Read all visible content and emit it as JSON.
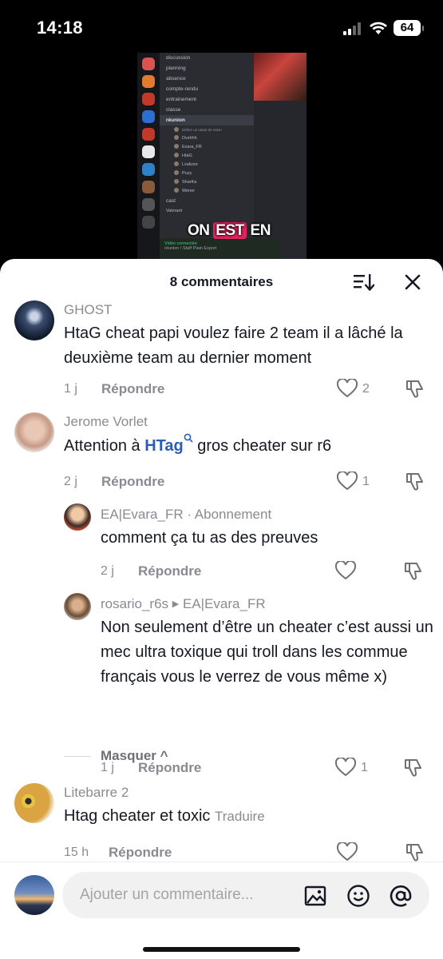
{
  "status_bar": {
    "time": "14:18",
    "battery": "64"
  },
  "video": {
    "caption_parts": [
      "ON",
      "EST",
      "EN"
    ],
    "channels": [
      "discussion",
      "planning",
      "absence",
      "compte-rendu",
      "entrainement",
      "classe"
    ],
    "voice_channel": "réunion",
    "voice_status": "Définir un statut de salon",
    "voice_users": [
      "Dvshhh",
      "Evara_FR",
      "HtaG",
      "Lvalizze",
      "Puzy",
      "SharKa",
      "Wener"
    ],
    "other_channels": [
      "cast"
    ],
    "category": "Valorant",
    "connection_status": "Vidéo connectée",
    "connection_detail": "réunion / Staff Plain Export"
  },
  "sheet": {
    "title": "8 commentaires",
    "hide_label": "Masquer ^",
    "input_placeholder": "Ajouter un commentaire..."
  },
  "comments": [
    {
      "username": "GHOST",
      "text": "HtaG cheat papi voulez faire 2 team il a lâché la deuxième team au dernier moment",
      "age": "1 j",
      "reply_label": "Répondre",
      "likes": "2"
    },
    {
      "username": "Jerome Vorlet",
      "text_before": "Attention à ",
      "mention": "HTag",
      "text_after": " gros cheater sur r6",
      "age": "2 j",
      "reply_label": "Répondre",
      "likes": "1"
    },
    {
      "username": "EA|Evara_FR · Abonnement",
      "text": "comment ça tu as des preuves",
      "age": "2 j",
      "reply_label": "Répondre",
      "likes": ""
    },
    {
      "username": "rosario_r6s",
      "reply_to": "EA|Evara_FR",
      "text": "Non seulement d’être un cheater c’est aussi un mec ultra toxique qui troll dans les commue français vous le verrez de vous même x)",
      "age": "1 j",
      "reply_label": "Répondre",
      "likes": "1"
    },
    {
      "username": "Litebarre 2",
      "text": "Htag cheater et toxic",
      "translate_label": "Traduire",
      "age": "15 h",
      "reply_label": "Répondre",
      "likes": ""
    }
  ]
}
